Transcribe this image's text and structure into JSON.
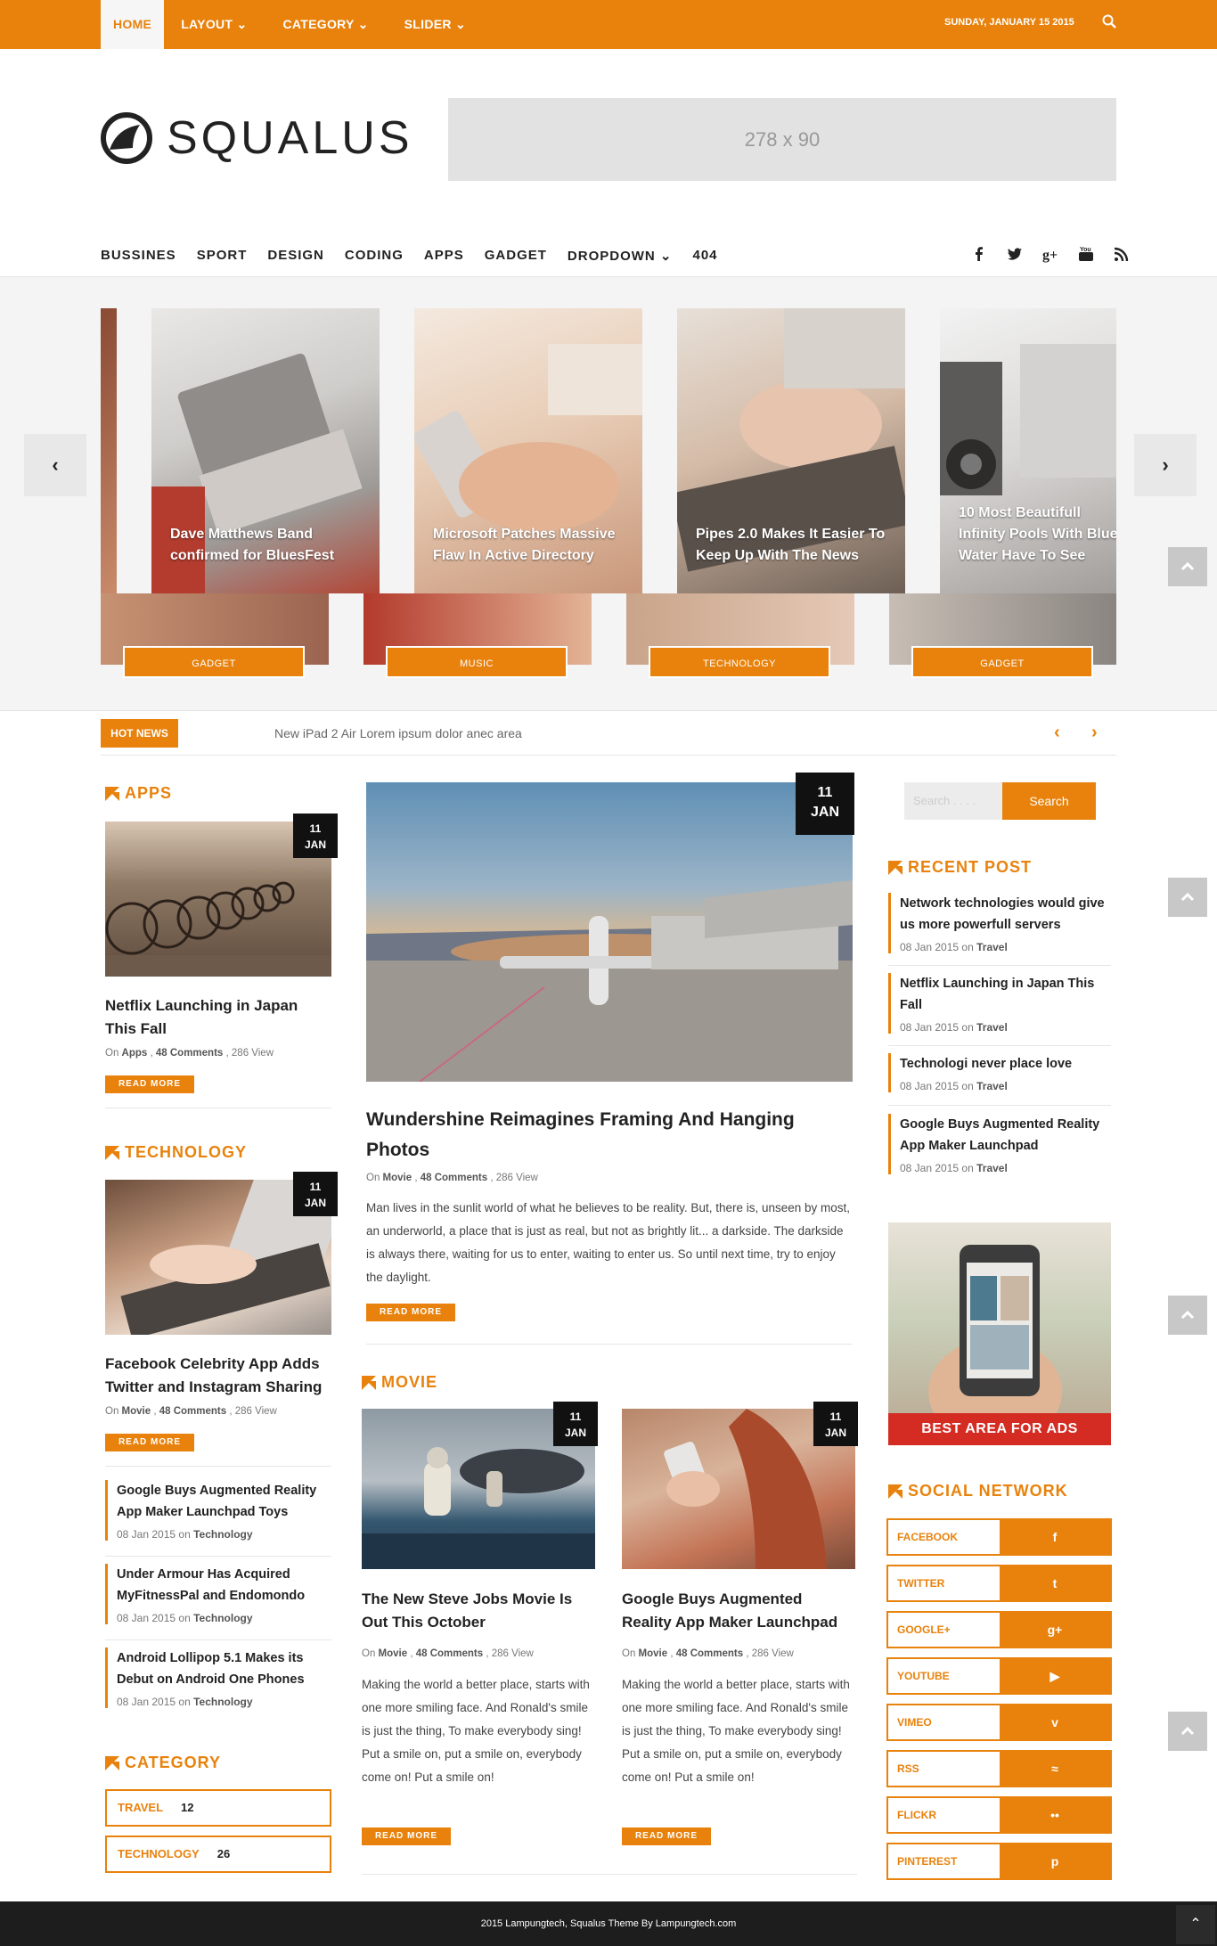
{
  "topbar": {
    "nav": [
      "HOME",
      "LAYOUT ⌄",
      "CATEGORY ⌄",
      "SLIDER ⌄"
    ],
    "date": "SUNDAY, JANUARY 15 2015",
    "search_icon": "search-icon"
  },
  "logo": {
    "name": "SQUALUS"
  },
  "ad_top": "278 x 90",
  "main_nav": [
    "BUSSINES",
    "SPORT",
    "DESIGN",
    "CODING",
    "APPS",
    "GADGET",
    "DROPDOWN ⌄",
    "404"
  ],
  "social_icons": [
    "facebook-icon",
    "twitter-icon",
    "googleplus-icon",
    "youtube-icon",
    "rss-icon"
  ],
  "slider": {
    "prev": "‹",
    "next": "›",
    "slides": [
      {
        "title": "Dave Matthews Band confirmed for BluesFest",
        "category": "GADGET"
      },
      {
        "title": "Microsoft Patches Massive Flaw In Active Directory",
        "category": "MUSIC"
      },
      {
        "title": "Pipes 2.0 Makes It Easier To Keep Up With The News",
        "category": "TECHNOLOGY"
      },
      {
        "title": "10 Most Beautifull Infinity Pools With Blue Water Have To See",
        "category": "GADGET"
      }
    ]
  },
  "hotnews": {
    "label": "HOT NEWS",
    "text": "New iPad 2 Air Lorem ipsum dolor anec area",
    "prev": "‹",
    "next": "›"
  },
  "left": {
    "apps_title": "APPS",
    "apps_post": {
      "day": "11",
      "month": "JAN",
      "title": "Netflix Launching in Japan This Fall",
      "meta_on": "On",
      "cat": "Apps",
      "comments": "48 Comments",
      "views": "286 View",
      "read_more": "READ MORE"
    },
    "tech_title": "TECHNOLOGY",
    "tech_post": {
      "day": "11",
      "month": "JAN",
      "title": "Facebook Celebrity App Adds Twitter and Instagram Sharing",
      "meta_on": "On",
      "cat": "Movie",
      "comments": "48 Comments",
      "views": "286 View",
      "read_more": "READ MORE"
    },
    "tech_list": [
      {
        "title": "Google Buys Augmented Reality App Maker Launchpad Toys",
        "date": "08 Jan 2015",
        "on": "on",
        "cat": "Technology"
      },
      {
        "title": "Under Armour Has Acquired MyFitnessPal and Endomondo",
        "date": "08 Jan 2015",
        "on": "on",
        "cat": "Technology"
      },
      {
        "title": "Android Lollipop 5.1 Makes its Debut on Android One Phones",
        "date": "08 Jan 2015",
        "on": "on",
        "cat": "Technology"
      }
    ],
    "category_title": "CATEGORY",
    "categories": [
      {
        "name": "TRAVEL",
        "count": "12"
      },
      {
        "name": "TECHNOLOGY",
        "count": "26"
      }
    ]
  },
  "center": {
    "featured": {
      "day": "11",
      "month": "JAN",
      "title": "Wundershine Reimagines Framing And Hanging Photos",
      "meta_on": "On",
      "cat": "Movie",
      "comments": "48 Comments",
      "views": "286 View",
      "excerpt": "Man lives in the sunlit world of what he believes to be reality. But, there is, unseen by most, an underworld, a place that is just as real, but not as brightly lit... a darkside. The darkside is always there, waiting for us to enter, waiting to enter us. So until next time, try to enjoy the daylight.",
      "read_more": "READ MORE"
    },
    "movie_title": "MOVIE",
    "movies": [
      {
        "day": "11",
        "month": "JAN",
        "title": "The New Steve Jobs Movie Is Out This October",
        "meta_on": "On",
        "cat": "Movie",
        "comments": "48 Comments",
        "views": "286 View",
        "excerpt": "Making the world a better place, starts with one more smiling face. And Ronald's smile is just the thing, To make everybody sing! Put a smile on, put a smile on, everybody come on! Put a smile on!",
        "read_more": "READ MORE"
      },
      {
        "day": "11",
        "month": "JAN",
        "title": "Google Buys Augmented Reality App Maker Launchpad",
        "meta_on": "On",
        "cat": "Movie",
        "comments": "48 Comments",
        "views": "286 View",
        "excerpt": "Making the world a better place, starts with one more smiling face. And Ronald's smile is just the thing, To make everybody sing! Put a smile on, put a smile on, everybody come on! Put a smile on!",
        "read_more": "READ MORE"
      }
    ]
  },
  "right": {
    "search_placeholder": "Search . . . .",
    "search_button": "Search",
    "recent_title": "RECENT POST",
    "recent": [
      {
        "title": "Network technologies would give us more powerfull servers",
        "date": "08 Jan 2015",
        "on": "on",
        "cat": "Travel"
      },
      {
        "title": "Netflix Launching in Japan This Fall",
        "date": "08 Jan 2015",
        "on": "on",
        "cat": "Travel"
      },
      {
        "title": "Technologi never place love",
        "date": "08 Jan 2015",
        "on": "on",
        "cat": "Travel"
      },
      {
        "title": "Google Buys Augmented Reality App Maker Launchpad",
        "date": "08 Jan 2015",
        "on": "on",
        "cat": "Travel"
      }
    ],
    "ad_label": "BEST AREA FOR ADS",
    "social_title": "SOCIAL NETWORK",
    "social": [
      {
        "name": "FACEBOOK",
        "icon": "f"
      },
      {
        "name": "TWITTER",
        "icon": "t"
      },
      {
        "name": "GOOGLE+",
        "icon": "g+"
      },
      {
        "name": "YOUTUBE",
        "icon": "▶"
      },
      {
        "name": "VIMEO",
        "icon": "v"
      },
      {
        "name": "RSS",
        "icon": "≈"
      },
      {
        "name": "FLICKR",
        "icon": "••"
      },
      {
        "name": "PINTEREST",
        "icon": "p"
      }
    ]
  },
  "footer": {
    "text": "2015 Lampungtech, Squalus Theme By Lampungtech.com",
    "up": "⌃"
  },
  "colors": {
    "accent": "#e8820c",
    "dark": "#1d1d1d",
    "ad_red": "#d42b22"
  }
}
